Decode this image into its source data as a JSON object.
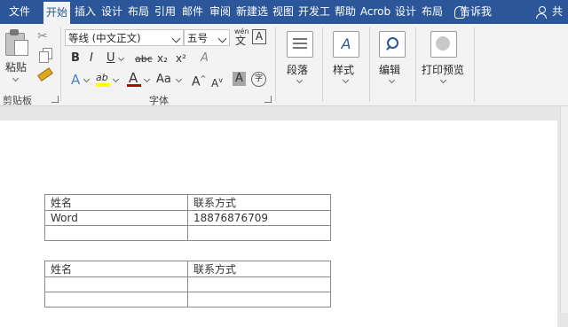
{
  "tabs": [
    {
      "label": "文件",
      "active": false
    },
    {
      "label": "开始",
      "active": true
    },
    {
      "label": "插入",
      "active": false
    },
    {
      "label": "设计",
      "active": false
    },
    {
      "label": "布局",
      "active": false
    },
    {
      "label": "引用",
      "active": false
    },
    {
      "label": "邮件",
      "active": false
    },
    {
      "label": "审阅",
      "active": false
    },
    {
      "label": "新建选",
      "active": false
    },
    {
      "label": "视图",
      "active": false
    },
    {
      "label": "开发工",
      "active": false
    },
    {
      "label": "帮助",
      "active": false
    },
    {
      "label": "Acrob",
      "active": false
    },
    {
      "label": "设计",
      "active": false
    },
    {
      "label": "布局",
      "active": false
    }
  ],
  "tell_me": "告诉我",
  "share": "共",
  "clipboard": {
    "paste": "粘贴",
    "group": "剪贴板"
  },
  "font": {
    "name": "等线 (中文正文)",
    "size": "五号",
    "bold": "B",
    "italic": "I",
    "underline": "U",
    "strike": "abc",
    "sub": "x₂",
    "sup": "x²",
    "text_effect": "A",
    "highlight": "ab",
    "font_color": "A",
    "case": "Aa",
    "grow": "A",
    "shrink": "A",
    "shade": "A",
    "enclose": "字",
    "clear": "A",
    "phonetic": "wén",
    "border_char": "A",
    "group": "字体"
  },
  "paragraph": "段落",
  "styles": "样式",
  "editing": "编辑",
  "print_preview": "打印预览",
  "colors": {
    "accent": "#2b579a",
    "font_color": "#c00000",
    "highlight": "#ffff00"
  },
  "tables": [
    {
      "rows": [
        [
          "姓名",
          "联系方式"
        ],
        [
          "Word",
          "18876876709"
        ],
        [
          "",
          ""
        ]
      ]
    },
    {
      "rows": [
        [
          "姓名",
          "联系方式"
        ],
        [
          "",
          ""
        ],
        [
          "",
          ""
        ]
      ]
    }
  ]
}
